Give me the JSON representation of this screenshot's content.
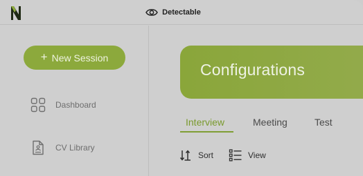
{
  "header": {
    "title": "Detectable",
    "logo_icon": "app-logo-icon",
    "title_icon": "eye-icon"
  },
  "sidebar": {
    "new_session_label": "New Session",
    "items": [
      {
        "label": "Dashboard",
        "icon": "grid-icon"
      },
      {
        "label": "CV Library",
        "icon": "document-icon"
      }
    ]
  },
  "main": {
    "hero_title": "Configurations",
    "tabs": [
      {
        "label": "Interview",
        "active": true
      },
      {
        "label": "Meeting",
        "active": false
      },
      {
        "label": "Test",
        "active": false
      }
    ],
    "toolbar": {
      "sort_label": "Sort",
      "view_label": "View"
    }
  },
  "colors": {
    "accent": "#8ca93c",
    "background": "#cfcfcf"
  }
}
